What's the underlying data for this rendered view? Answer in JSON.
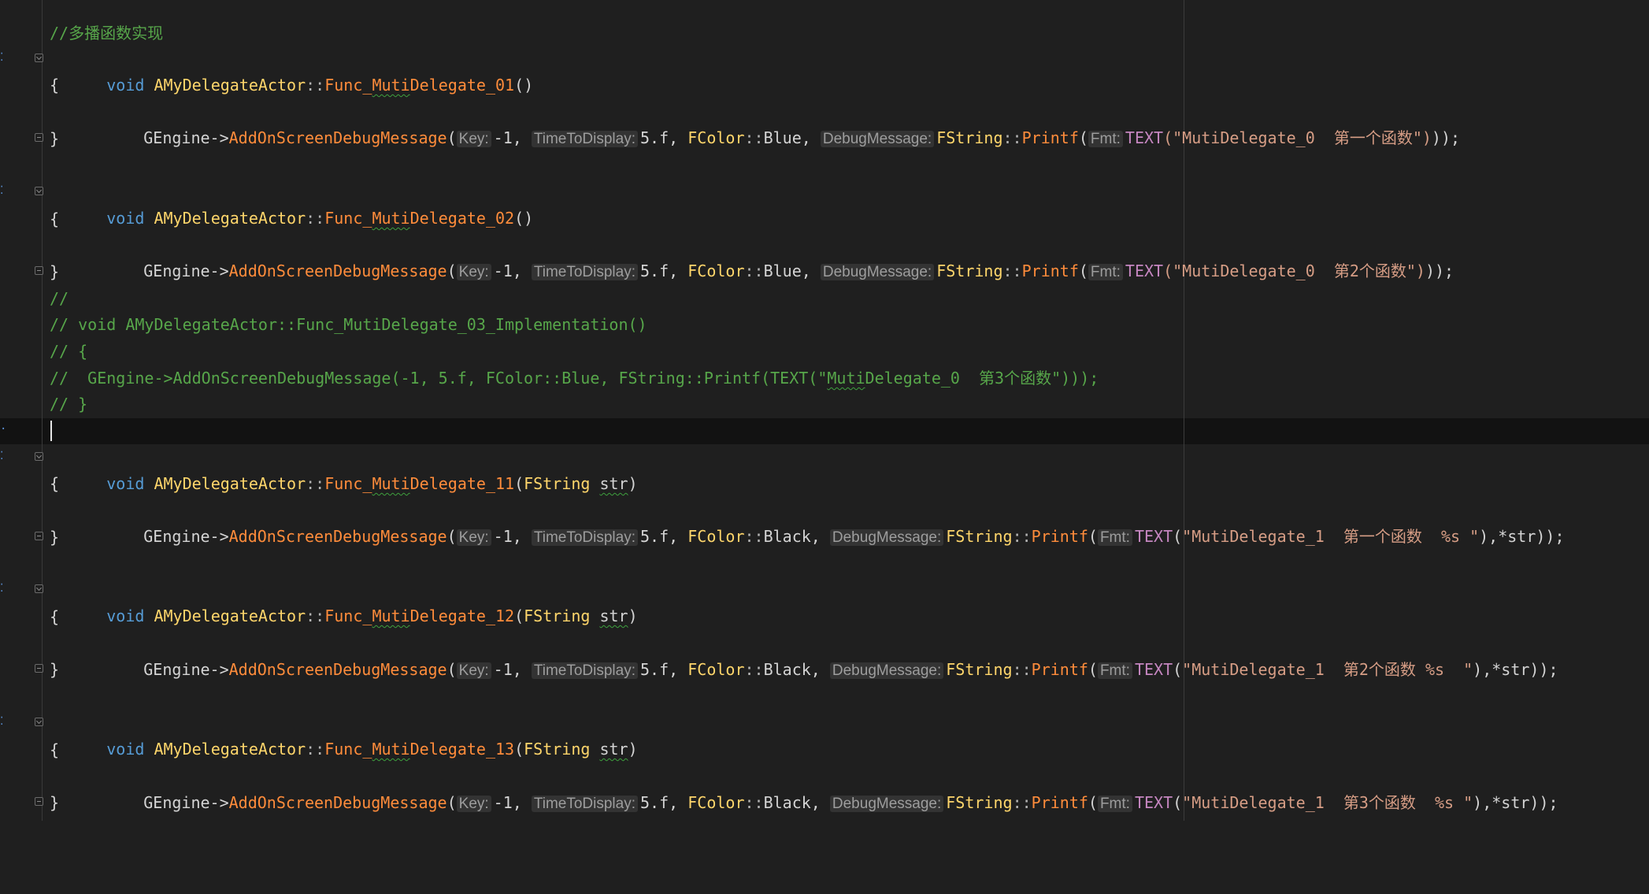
{
  "lines": {
    "l1": "//多播函数实现",
    "l2": {
      "void": "void",
      "cls": "AMyDelegateActor",
      "sep": "::",
      "fn_pre": "Func_",
      "fn_sq": "Muti",
      "fn_post": "Delegate_01",
      "args": "()"
    },
    "open_brace": "{",
    "close_brace": "}",
    "l4": {
      "obj": "GEngine",
      "arrow": "->",
      "fn": "AddOnScreenDebugMessage",
      "p": "(",
      "hint_key": "Key:",
      "key": "-1, ",
      "hint_time": "TimeToDisplay:",
      "time": "5.f, ",
      "fcolor": "FColor",
      "sep": "::",
      "color": "Blue",
      "comma": ", ",
      "hint_msg": "DebugMessage:",
      "fstring": "FString",
      "printf": "Printf",
      "hint_fmt": "Fmt:",
      "text": "TEXT",
      "str": "(\"MutiDelegate_0  第一个函数\")",
      "end": "));"
    },
    "l6": {
      "fn_post": "Delegate_02"
    },
    "l8": {
      "str": "(\"MutiDelegate_0  第2个函数\")"
    },
    "c1": "//",
    "c2": "// void AMyDelegateActor::Func_MutiDelegate_03_Implementation()",
    "c3": "// {",
    "c4_a": "//  GEngine->AddOnScreenDebugMessage(-1, 5.f, FColor::Blue, FString::Printf(TEXT(\"",
    "c4_sq": "Muti",
    "c4_b": "Delegate_0  第3个函数\")));",
    "c5": "// }",
    "l16": {
      "fn_post": "Delegate_11",
      "fstr": "FString",
      "param": "str",
      "args_close": ")"
    },
    "black": "Black",
    "l18": {
      "str": "\"MutiDelegate_1  第一个函数  %s \""
    },
    "l21": {
      "fn_post": "Delegate_12"
    },
    "l23": {
      "str": "\"MutiDelegate_1  第2个函数 %s  \""
    },
    "l26": {
      "fn_post": "Delegate_13"
    },
    "l28": {
      "str": "\"MutiDelegate_1  第3个函数  %s \""
    },
    "deref_end": "),*str));"
  },
  "colors": {
    "background": "#1f1f1f",
    "keyword": "#569cd6",
    "class": "#ffd66b",
    "function": "#ff8c3b",
    "macro": "#c586c0",
    "string": "#d69d85",
    "comment": "#57a64a"
  }
}
